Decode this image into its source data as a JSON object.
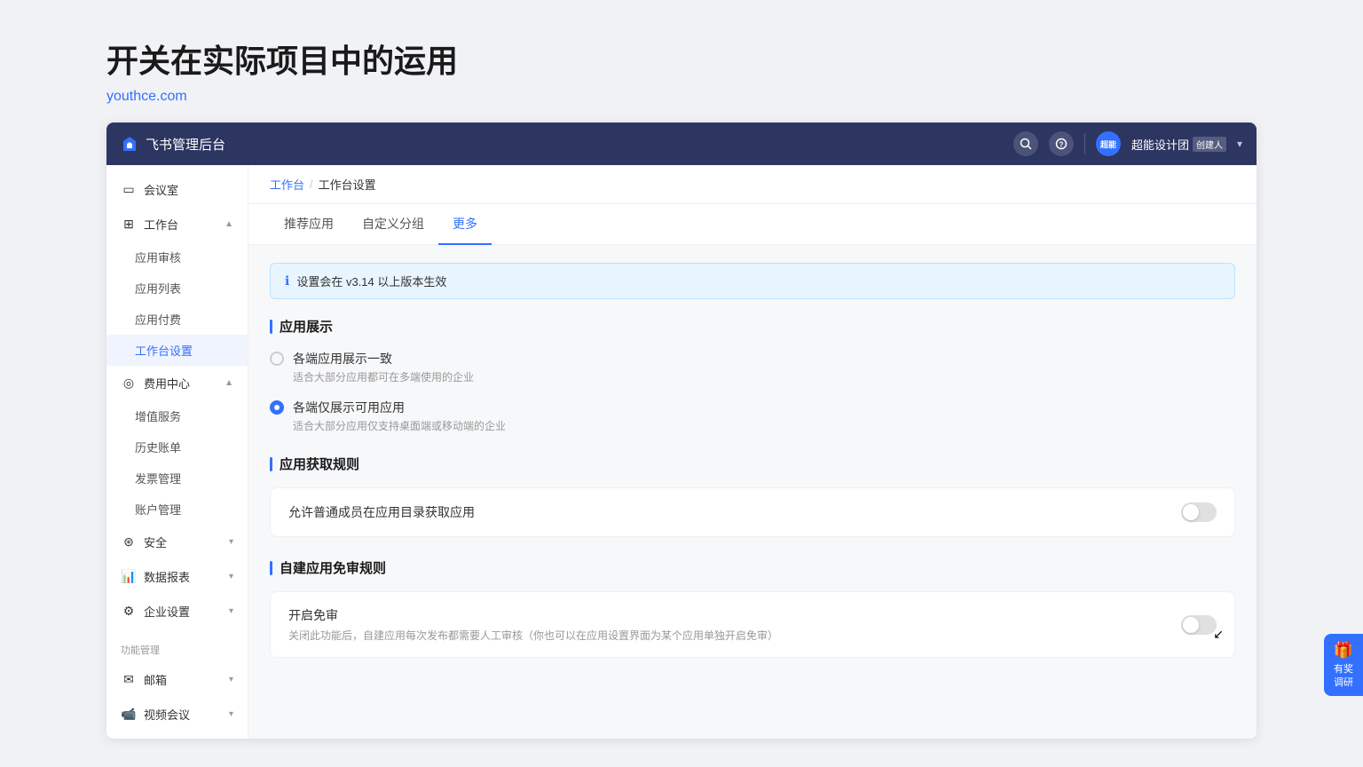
{
  "page": {
    "title": "开关在实际项目中的运用",
    "subtitle": "youthce.com"
  },
  "topnav": {
    "title": "飞书管理后台",
    "org_name": "超能设计团",
    "org_badge": "创建人",
    "avatar_text": "超能"
  },
  "sidebar": {
    "meeting_room": "会议室",
    "workspace": "工作台",
    "app_review": "应用审核",
    "app_list": "应用列表",
    "app_payment": "应用付费",
    "workspace_settings": "工作台设置",
    "billing": "费用中心",
    "value_added": "增值服务",
    "history_bill": "历史账单",
    "invoice": "发票管理",
    "account": "账户管理",
    "security": "安全",
    "data_report": "数据报表",
    "enterprise_settings": "企业设置",
    "function_management": "功能管理",
    "mailbox": "邮箱",
    "video_conf": "视频会议"
  },
  "breadcrumb": {
    "workspace": "工作台",
    "settings": "工作台设置"
  },
  "tabs": [
    {
      "label": "推荐应用",
      "active": false
    },
    {
      "label": "自定义分组",
      "active": false
    },
    {
      "label": "更多",
      "active": true
    }
  ],
  "notice": {
    "text": "设置会在 v3.14 以上版本生效"
  },
  "app_display": {
    "title": "应用展示",
    "option1_label": "各端应用展示一致",
    "option1_desc": "适合大部分应用都可在多端使用的企业",
    "option1_checked": false,
    "option2_label": "各端仅展示可用应用",
    "option2_desc": "适合大部分应用仅支持桌面端或移动端的企业",
    "option2_checked": true
  },
  "app_access": {
    "title": "应用获取规则",
    "item_label": "允许普通成员在应用目录获取应用",
    "toggle_on": false
  },
  "app_review": {
    "title": "自建应用免审规则",
    "item_label": "开启免审",
    "item_desc": "关闭此功能后，自建应用每次发布都需要人工审核（你也可以在应用设置界面为某个应用单独开启免审）",
    "toggle_on": false
  },
  "gift": {
    "icon": "🎁",
    "text": "有奖调研"
  }
}
